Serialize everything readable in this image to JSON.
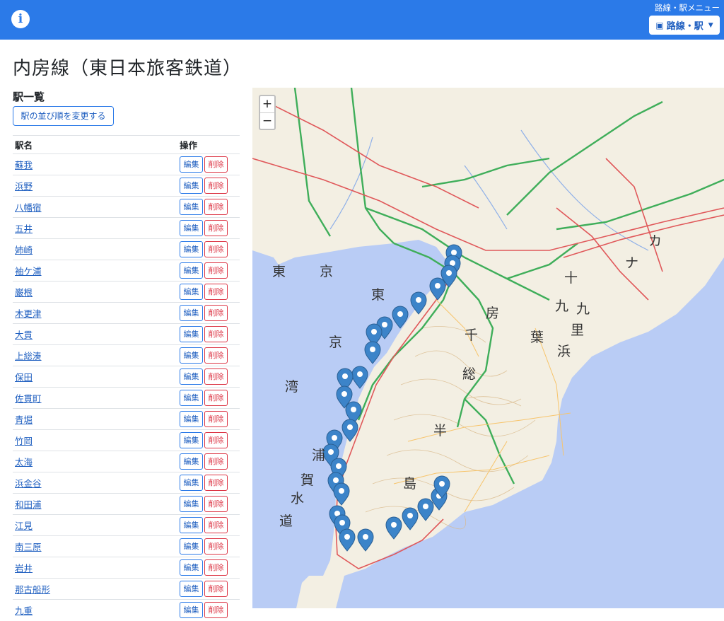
{
  "header": {
    "menu_caption": "路線・駅メニュー",
    "route_button": "路線・駅"
  },
  "page": {
    "title": "内房線（東日本旅客鉄道）",
    "section_title": "駅一覧",
    "order_button": "駅の並び順を変更する"
  },
  "table": {
    "col_name": "駅名",
    "col_ops": "操作",
    "edit_label": "編集",
    "delete_label": "削除",
    "stations": [
      "蘇我",
      "浜野",
      "八幡宿",
      "五井",
      "姉崎",
      "袖ケ浦",
      "巌根",
      "木更津",
      "大貫",
      "上総湊",
      "保田",
      "佐貫町",
      "青堀",
      "竹岡",
      "太海",
      "浜金谷",
      "和田浦",
      "江見",
      "南三原",
      "岩井",
      "那古船形",
      "九重"
    ]
  },
  "map": {
    "zoom_in": "+",
    "zoom_out": "−",
    "labels": [
      "東",
      "京",
      "東",
      "京",
      "湾",
      "浦",
      "賀",
      "水",
      "道",
      "房",
      "千",
      "葉",
      "総",
      "半",
      "島",
      "九",
      "十",
      "九",
      "里",
      "浜",
      "カ",
      "ナ"
    ],
    "colors": {
      "sea": "#b9ccf5",
      "land": "#f3efe3",
      "pin": "#3c84c9",
      "expressway": "#3fae5a",
      "rail": "#e0585a"
    }
  }
}
